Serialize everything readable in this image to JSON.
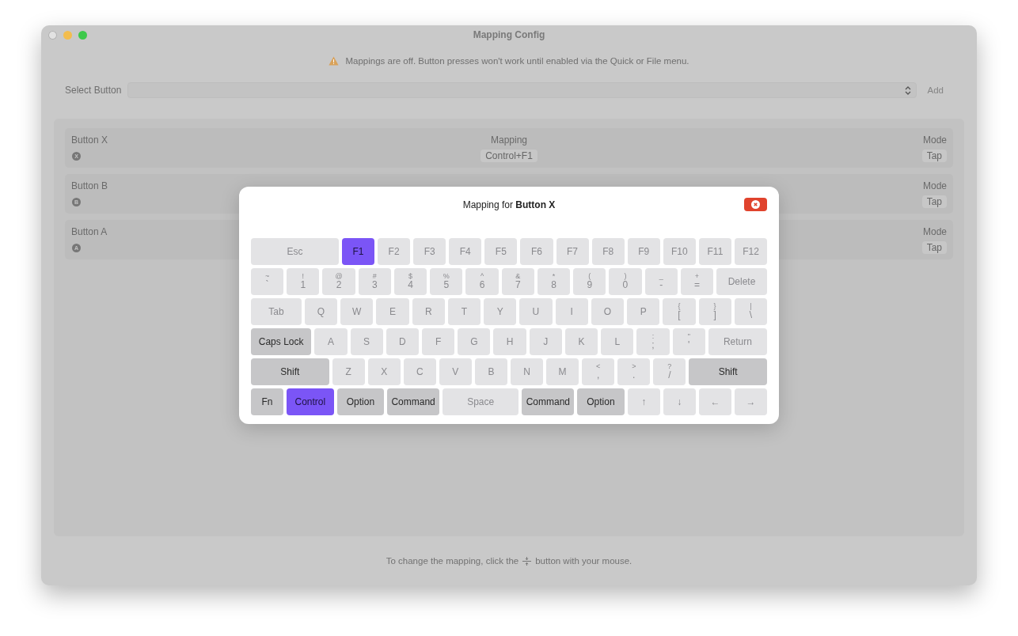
{
  "window": {
    "title": "Mapping Config"
  },
  "warning": {
    "text": "Mappings are off. Button presses won't work until enabled via the Quick or File menu."
  },
  "select": {
    "label": "Select Button",
    "add_button": {
      "label": "Add",
      "disabled": true
    }
  },
  "mappings": [
    {
      "name": "Button X",
      "badge": "X",
      "mapping_header": "Mapping",
      "mapping": "Control+F1",
      "mode_header": "Mode",
      "mode": "Tap"
    },
    {
      "name": "Button B",
      "badge": "B",
      "mode_header": "Mode",
      "mode": "Tap"
    },
    {
      "name": "Button A",
      "badge": "A",
      "mode_header": "Mode",
      "mode": "Tap"
    }
  ],
  "footer": {
    "before": "To change the mapping, click the",
    "after": "button with your mouse."
  },
  "dialog": {
    "title": "Mapping for **Button X**",
    "rows": [
      {
        "keys": [
          {
            "label": "Esc",
            "kind": "key",
            "selected": false
          },
          {
            "label": "F1",
            "kind": "key",
            "selected": true
          },
          {
            "label": "F2",
            "kind": "key",
            "selected": false
          },
          {
            "label": "F3",
            "kind": "key",
            "selected": false
          },
          {
            "label": "F4",
            "kind": "key",
            "selected": false
          },
          {
            "label": "F5",
            "kind": "key",
            "selected": false
          },
          {
            "label": "F6",
            "kind": "key",
            "selected": false
          },
          {
            "label": "F7",
            "kind": "key",
            "selected": false
          },
          {
            "label": "F8",
            "kind": "key",
            "selected": false
          },
          {
            "label": "F9",
            "kind": "key",
            "selected": false
          },
          {
            "label": "F10",
            "kind": "key",
            "selected": false
          },
          {
            "label": "F11",
            "kind": "key",
            "selected": false
          },
          {
            "label": "F12",
            "kind": "key",
            "selected": false
          }
        ]
      },
      {
        "keys": [
          {
            "shift": "~",
            "label": "`",
            "kind": "key",
            "selected": false
          },
          {
            "shift": "!",
            "label": "1",
            "kind": "key",
            "selected": false
          },
          {
            "shift": "@",
            "label": "2",
            "kind": "key",
            "selected": false
          },
          {
            "shift": "#",
            "label": "3",
            "kind": "key",
            "selected": false
          },
          {
            "shift": "$",
            "label": "4",
            "kind": "key",
            "selected": false
          },
          {
            "shift": "%",
            "label": "5",
            "kind": "key",
            "selected": false
          },
          {
            "shift": "^",
            "label": "6",
            "kind": "key",
            "selected": false
          },
          {
            "shift": "&",
            "label": "7",
            "kind": "key",
            "selected": false
          },
          {
            "shift": "*",
            "label": "8",
            "kind": "key",
            "selected": false
          },
          {
            "shift": "(",
            "label": "9",
            "kind": "key",
            "selected": false
          },
          {
            "shift": ")",
            "label": "0",
            "kind": "key",
            "selected": false
          },
          {
            "shift": "_",
            "label": "-",
            "kind": "key",
            "selected": false
          },
          {
            "shift": "+",
            "label": "=",
            "kind": "key",
            "selected": false
          },
          {
            "label": "Delete",
            "kind": "key",
            "selected": false
          }
        ]
      },
      {
        "keys": [
          {
            "label": "Tab",
            "kind": "key",
            "selected": false
          },
          {
            "label": "Q",
            "kind": "key",
            "selected": false
          },
          {
            "label": "W",
            "kind": "key",
            "selected": false
          },
          {
            "label": "E",
            "kind": "key",
            "selected": false
          },
          {
            "label": "R",
            "kind": "key",
            "selected": false
          },
          {
            "label": "T",
            "kind": "key",
            "selected": false
          },
          {
            "label": "Y",
            "kind": "key",
            "selected": false
          },
          {
            "label": "U",
            "kind": "key",
            "selected": false
          },
          {
            "label": "I",
            "kind": "key",
            "selected": false
          },
          {
            "label": "O",
            "kind": "key",
            "selected": false
          },
          {
            "label": "P",
            "kind": "key",
            "selected": false
          },
          {
            "shift": "{",
            "label": "[",
            "kind": "key",
            "selected": false
          },
          {
            "shift": "}",
            "label": "]",
            "kind": "key",
            "selected": false
          },
          {
            "shift": "|",
            "label": "\\",
            "kind": "key",
            "selected": false
          }
        ]
      },
      {
        "keys": [
          {
            "label": "Caps Lock",
            "kind": "modifier",
            "selected": false
          },
          {
            "label": "A",
            "kind": "key",
            "selected": false
          },
          {
            "label": "S",
            "kind": "key",
            "selected": false
          },
          {
            "label": "D",
            "kind": "key",
            "selected": false
          },
          {
            "label": "F",
            "kind": "key",
            "selected": false
          },
          {
            "label": "G",
            "kind": "key",
            "selected": false
          },
          {
            "label": "H",
            "kind": "key",
            "selected": false
          },
          {
            "label": "J",
            "kind": "key",
            "selected": false
          },
          {
            "label": "K",
            "kind": "key",
            "selected": false
          },
          {
            "label": "L",
            "kind": "key",
            "selected": false
          },
          {
            "shift": ":",
            "label": ";",
            "kind": "key",
            "selected": false
          },
          {
            "shift": "\"",
            "label": "'",
            "kind": "key",
            "selected": false
          },
          {
            "label": "Return",
            "kind": "key",
            "selected": false
          }
        ]
      },
      {
        "keys": [
          {
            "label": "Shift",
            "kind": "modifier",
            "selected": false
          },
          {
            "label": "Z",
            "kind": "key",
            "selected": false
          },
          {
            "label": "X",
            "kind": "key",
            "selected": false
          },
          {
            "label": "C",
            "kind": "key",
            "selected": false
          },
          {
            "label": "V",
            "kind": "key",
            "selected": false
          },
          {
            "label": "B",
            "kind": "key",
            "selected": false
          },
          {
            "label": "N",
            "kind": "key",
            "selected": false
          },
          {
            "label": "M",
            "kind": "key",
            "selected": false
          },
          {
            "shift": "<",
            "label": ",",
            "kind": "key",
            "selected": false
          },
          {
            "shift": ">",
            "label": ".",
            "kind": "key",
            "selected": false
          },
          {
            "shift": "?",
            "label": "/",
            "kind": "key",
            "selected": false
          },
          {
            "label": "Shift",
            "kind": "modifier",
            "selected": false
          }
        ]
      },
      {
        "keys": [
          {
            "label": "Fn",
            "kind": "modifier",
            "selected": false
          },
          {
            "label": "Control",
            "kind": "modifier",
            "selected": true
          },
          {
            "label": "Option",
            "kind": "modifier",
            "selected": false
          },
          {
            "label": "Command",
            "kind": "modifier",
            "selected": false
          },
          {
            "label": "Space",
            "kind": "key",
            "selected": false
          },
          {
            "label": "Command",
            "kind": "modifier",
            "selected": false
          },
          {
            "label": "Option",
            "kind": "modifier",
            "selected": false
          },
          {
            "label": "↑",
            "kind": "key",
            "selected": false
          },
          {
            "label": "↓",
            "kind": "key",
            "selected": false
          },
          {
            "label": "←",
            "kind": "key",
            "selected": false
          },
          {
            "label": "→",
            "kind": "key",
            "selected": false
          }
        ]
      }
    ]
  }
}
